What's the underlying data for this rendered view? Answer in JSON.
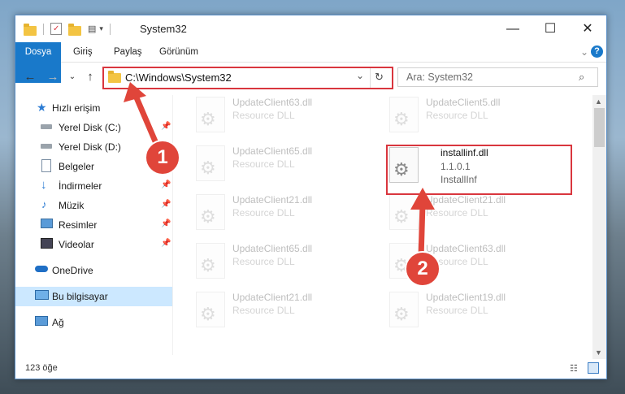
{
  "window": {
    "title": "System32"
  },
  "window_buttons": {
    "minimize": "—",
    "maximize": "☐",
    "close": "✕"
  },
  "ribbon": {
    "tabs": [
      "Dosya",
      "Giriş",
      "Paylaş",
      "Görünüm"
    ],
    "help": "?"
  },
  "address": {
    "path": "C:\\Windows\\System32",
    "chevron": "⌄",
    "refresh": "↻"
  },
  "search": {
    "placeholder": "Ara: System32"
  },
  "nav_glyphs": {
    "back": "←",
    "forward": "→",
    "recent": "⌄",
    "up": "↑"
  },
  "sidebar": {
    "items": [
      {
        "label": "Hızlı erişim",
        "icon": "star-icon",
        "pinned": false
      },
      {
        "label": "Yerel Disk (C:)",
        "icon": "drive-icon",
        "pinned": true
      },
      {
        "label": "Yerel Disk (D:)",
        "icon": "drive-icon",
        "pinned": false
      },
      {
        "label": "Belgeler",
        "icon": "documents-icon",
        "pinned": false
      },
      {
        "label": "İndirmeler",
        "icon": "download-icon",
        "pinned": true
      },
      {
        "label": "Müzik",
        "icon": "music-icon",
        "pinned": true
      },
      {
        "label": "Resimler",
        "icon": "pictures-icon",
        "pinned": true
      },
      {
        "label": "Videolar",
        "icon": "videos-icon",
        "pinned": true
      },
      {
        "label": "OneDrive",
        "icon": "onedrive-icon",
        "pinned": false
      },
      {
        "label": "Bu bilgisayar",
        "icon": "computer-icon",
        "pinned": false,
        "selected": true
      },
      {
        "label": "Ağ",
        "icon": "network-icon",
        "pinned": false
      }
    ]
  },
  "files": {
    "left": [
      {
        "name": "UpdateClient63.dll",
        "sub1": "Resource DLL"
      },
      {
        "name": "UpdateClient65.dll",
        "sub1": "Resource DLL"
      },
      {
        "name": "UpdateClient21.dll",
        "sub1": "Resource DLL"
      },
      {
        "name": "UpdateClient65.dll",
        "sub1": "Resource DLL"
      },
      {
        "name": "UpdateClient21.dll",
        "sub1": "Resource DLL"
      }
    ],
    "right": [
      {
        "name": "UpdateClient5.dll",
        "sub1": "Resource DLL"
      },
      {
        "name": "installinf.dll",
        "sub1": "1.1.0.1",
        "sub2": "InstallInf",
        "highlight": true
      },
      {
        "name": "UpdateClient21.dll",
        "sub1": "Resource DLL"
      },
      {
        "name": "UpdateClient63.dll",
        "sub1": "Resource DLL"
      },
      {
        "name": "UpdateClient19.dll",
        "sub1": "Resource DLL"
      }
    ]
  },
  "status": {
    "count": "123 öğe"
  },
  "annotations": {
    "step1": "1",
    "step2": "2"
  },
  "colors": {
    "accent": "#1979ca",
    "highlight": "#d9363e",
    "selected_bg": "#cce8ff"
  }
}
